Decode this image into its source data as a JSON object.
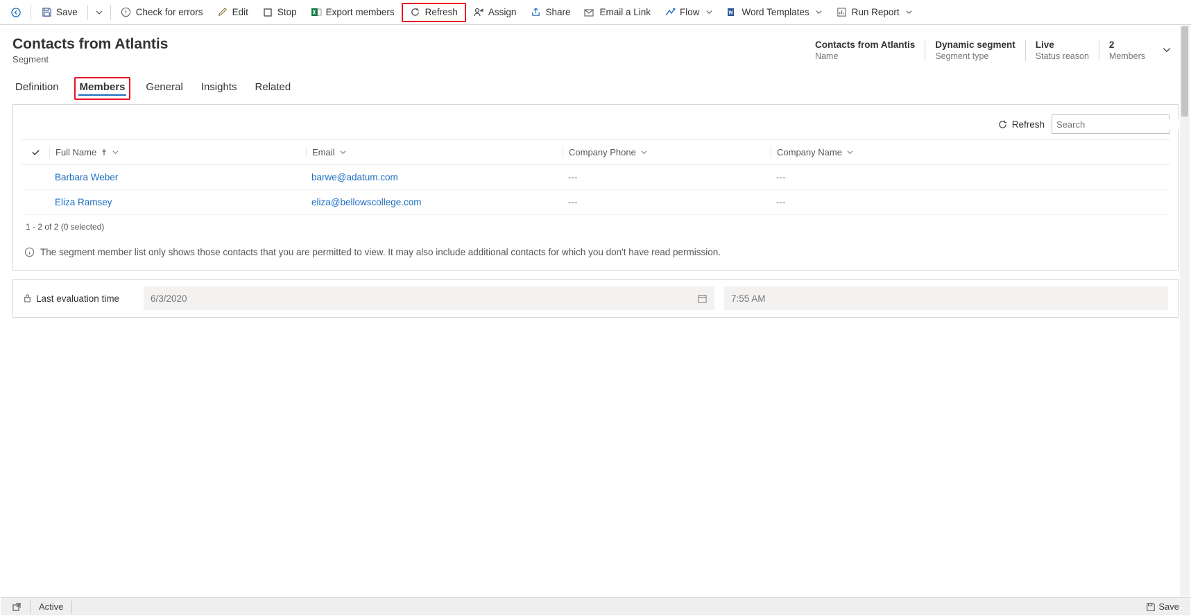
{
  "toolbar": {
    "save": "Save",
    "check": "Check for errors",
    "edit": "Edit",
    "stop": "Stop",
    "export": "Export members",
    "refresh": "Refresh",
    "assign": "Assign",
    "share": "Share",
    "email": "Email a Link",
    "flow": "Flow",
    "word": "Word Templates",
    "run": "Run Report"
  },
  "header": {
    "title": "Contacts from Atlantis",
    "subtitle": "Segment",
    "facts": {
      "name_val": "Contacts from Atlantis",
      "name_lbl": "Name",
      "type_val": "Dynamic segment",
      "type_lbl": "Segment type",
      "status_val": "Live",
      "status_lbl": "Status reason",
      "members_val": "2",
      "members_lbl": "Members"
    }
  },
  "tabs": {
    "definition": "Definition",
    "members": "Members",
    "general": "General",
    "insights": "Insights",
    "related": "Related"
  },
  "panel": {
    "refresh": "Refresh",
    "search_placeholder": "Search",
    "cols": {
      "name": "Full Name",
      "email": "Email",
      "phone": "Company Phone",
      "company": "Company Name"
    },
    "rows": [
      {
        "name": "Barbara Weber",
        "email": "barwe@adatum.com",
        "phone": "---",
        "company": "---"
      },
      {
        "name": "Eliza Ramsey",
        "email": "eliza@bellowscollege.com",
        "phone": "---",
        "company": "---"
      }
    ],
    "paging": "1 - 2 of 2 (0 selected)",
    "info": "The segment member list only shows those contacts that you are permitted to view. It may also include additional contacts for which you don't have read permission."
  },
  "eval": {
    "label": "Last evaluation time",
    "date": "6/3/2020",
    "time": "7:55 AM"
  },
  "status": {
    "active": "Active",
    "save": "Save"
  }
}
